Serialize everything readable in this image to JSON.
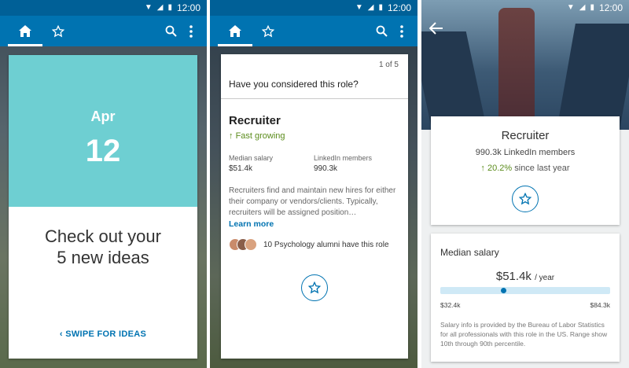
{
  "status": {
    "time": "12:00",
    "icons": [
      "wifi-icon",
      "signal-icon",
      "battery-icon"
    ]
  },
  "nav": {
    "icons": [
      "home-icon",
      "star-icon",
      "search-icon",
      "more-vert-icon"
    ]
  },
  "screen1": {
    "month": "Apr",
    "day": "12",
    "headline": "Check out your\n5 new ideas",
    "swipe_label": "SWIPE FOR IDEAS"
  },
  "screen2": {
    "counter": "1 of 5",
    "question": "Have you considered this role?",
    "role": "Recruiter",
    "growth": "Fast growing",
    "median_label": "Median salary",
    "median_value": "$51.4k",
    "members_label": "LinkedIn members",
    "members_value": "990.3k",
    "description": "Recruiters find and maintain new hires for either their company or vendors/clients. Typically, recruiters will be assigned position…",
    "learn_more": "Learn more",
    "alumni_text": "10 Psychology alumni have this role"
  },
  "screen3": {
    "role": "Recruiter",
    "members": "990.3k LinkedIn members",
    "growth_pct": "20.2%",
    "growth_suffix": "since last year",
    "salary_title": "Median salary",
    "salary_value": "$51.4k",
    "salary_unit": "/ year",
    "salary_min": "$32.4k",
    "salary_max": "$84.3k",
    "salary_position": 0.37,
    "note": "Salary info is provided by the Bureau of Labor Statistics for all professionals with this role in the US. Range show 10th through 90th percentile."
  },
  "colors": {
    "brand": "#0073b1",
    "status_bar": "#006097",
    "teal": "#6ecfd2",
    "growth": "#5b8c1c"
  }
}
